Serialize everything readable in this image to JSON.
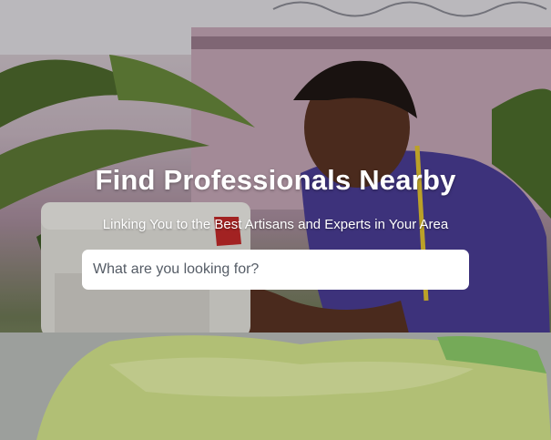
{
  "hero": {
    "title": "Find Professionals Nearby",
    "subtitle": "Linking You to the Best Artisans and Experts in Your Area",
    "search": {
      "placeholder": "What are you looking for?",
      "value": ""
    }
  },
  "colors": {
    "text": "#ffffff",
    "search_bg": "#ffffff",
    "placeholder": "#555c66"
  }
}
